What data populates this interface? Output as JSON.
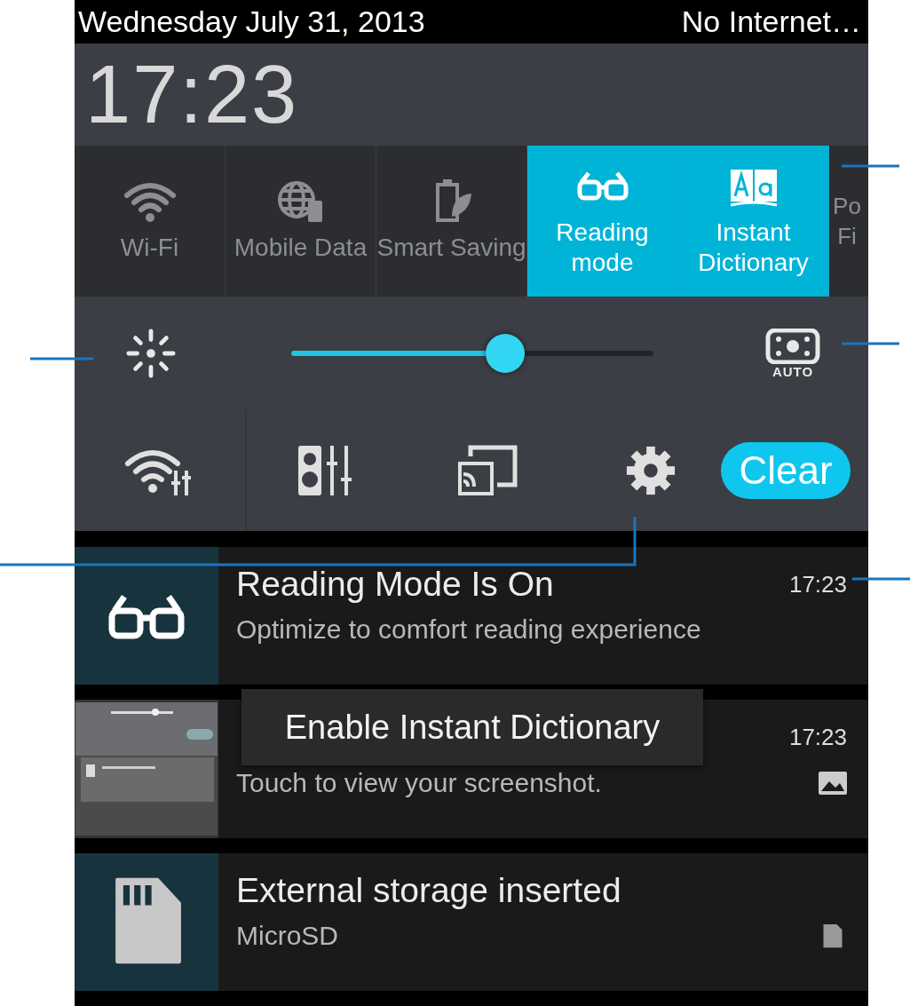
{
  "status_bar": {
    "date": "Wednesday July 31, 2013",
    "network": "No Internet…"
  },
  "clock": "17:23",
  "quick_tiles": [
    {
      "kind": "wifi",
      "label": "Wi-Fi",
      "selected": false
    },
    {
      "kind": "globe",
      "label": "Mobile Data",
      "selected": false
    },
    {
      "kind": "battery",
      "label": "Smart Saving",
      "selected": false
    },
    {
      "kind": "glasses",
      "label": "Reading mode",
      "selected": true
    },
    {
      "kind": "book",
      "label": "Instant Dictionary",
      "selected": true
    },
    {
      "kind": "cut",
      "label": "Po Fi",
      "selected": false
    }
  ],
  "brightness": {
    "level": 0.59,
    "auto_label": "AUTO"
  },
  "clear_button": "Clear",
  "toast": "Enable Instant Dictionary",
  "notifications": [
    {
      "kind": "reading",
      "title": "Reading Mode Is On",
      "text": "Optimize to comfort reading experience",
      "time": "17:23"
    },
    {
      "kind": "screenshot",
      "text": "Touch to view your screenshot.",
      "time": "17:23"
    },
    {
      "kind": "storage",
      "title": "External storage inserted",
      "text": "MicroSD"
    }
  ]
}
